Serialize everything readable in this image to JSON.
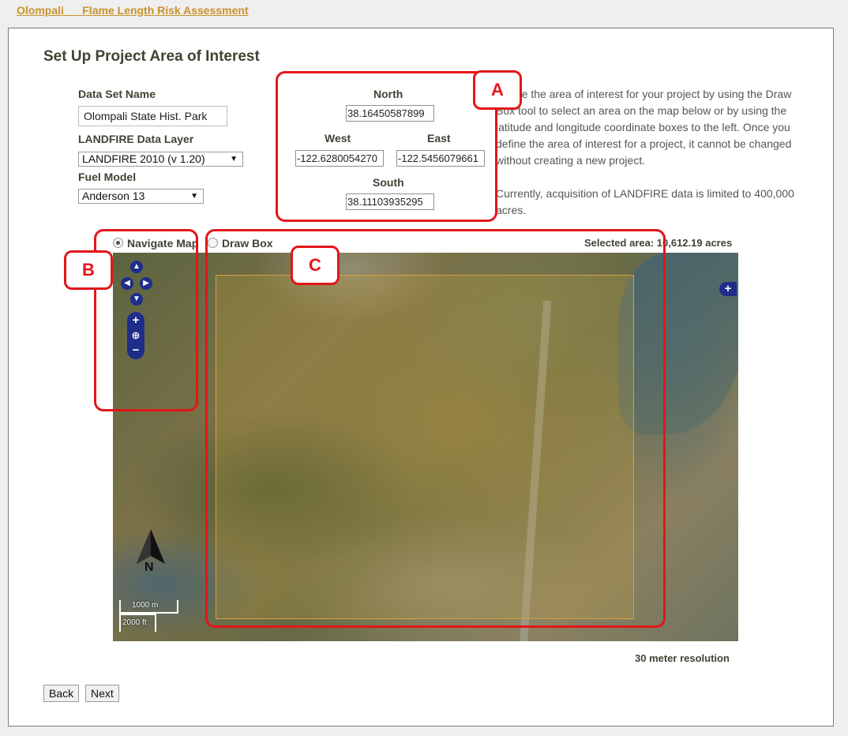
{
  "header": {
    "link_text": "Olompali __ Flame Length Risk Assessment"
  },
  "page": {
    "title": "Set Up Project Area of Interest"
  },
  "form": {
    "dataset_label": "Data Set Name",
    "dataset_value": "Olompali State Hist. Park",
    "layer_label": "LANDFIRE Data Layer",
    "layer_selected": "LANDFIRE 2010 (v 1.20)",
    "fuel_label": "Fuel Model",
    "fuel_selected": "Anderson 13"
  },
  "coords": {
    "north_label": "North",
    "north_value": "38.16450587899",
    "west_label": "West",
    "west_value": "-122.6280054270",
    "east_label": "East",
    "east_value": "-122.5456079661",
    "south_label": "South",
    "south_value": "38.11103935295"
  },
  "help": {
    "para1": "Define the area of interest for your project by using the Draw Box tool to select an area on the map below or by using the latitude and longitude coordinate boxes to the left. Once you define the area of interest for a project, it cannot be changed without creating a new project.",
    "para2": "Currently, acquisition of LANDFIRE data is limited to 400,000 acres."
  },
  "map_mode": {
    "navigate_label": "Navigate Map",
    "draw_label": "Draw Box",
    "selected": "navigate"
  },
  "map": {
    "selected_area": "Selected area: 10,612.19 acres",
    "scale_metric": "1000 m",
    "scale_imperial": "2000 ft",
    "north_letter": "N",
    "resolution": "30 meter resolution"
  },
  "annotations": {
    "a": "A",
    "b": "B",
    "c": "C"
  },
  "buttons": {
    "back": "Back",
    "next": "Next"
  },
  "colors": {
    "callout": "#e2161a",
    "map_controls": "#1f2d8a",
    "selection_border": "#d7a13a",
    "link": "#c9922a"
  },
  "icons": {
    "pan": "pan-arrows-icon",
    "zoom_in": "plus-icon",
    "zoom_out": "minus-icon",
    "zoom_world": "globe-icon",
    "north": "north-arrow-icon"
  }
}
